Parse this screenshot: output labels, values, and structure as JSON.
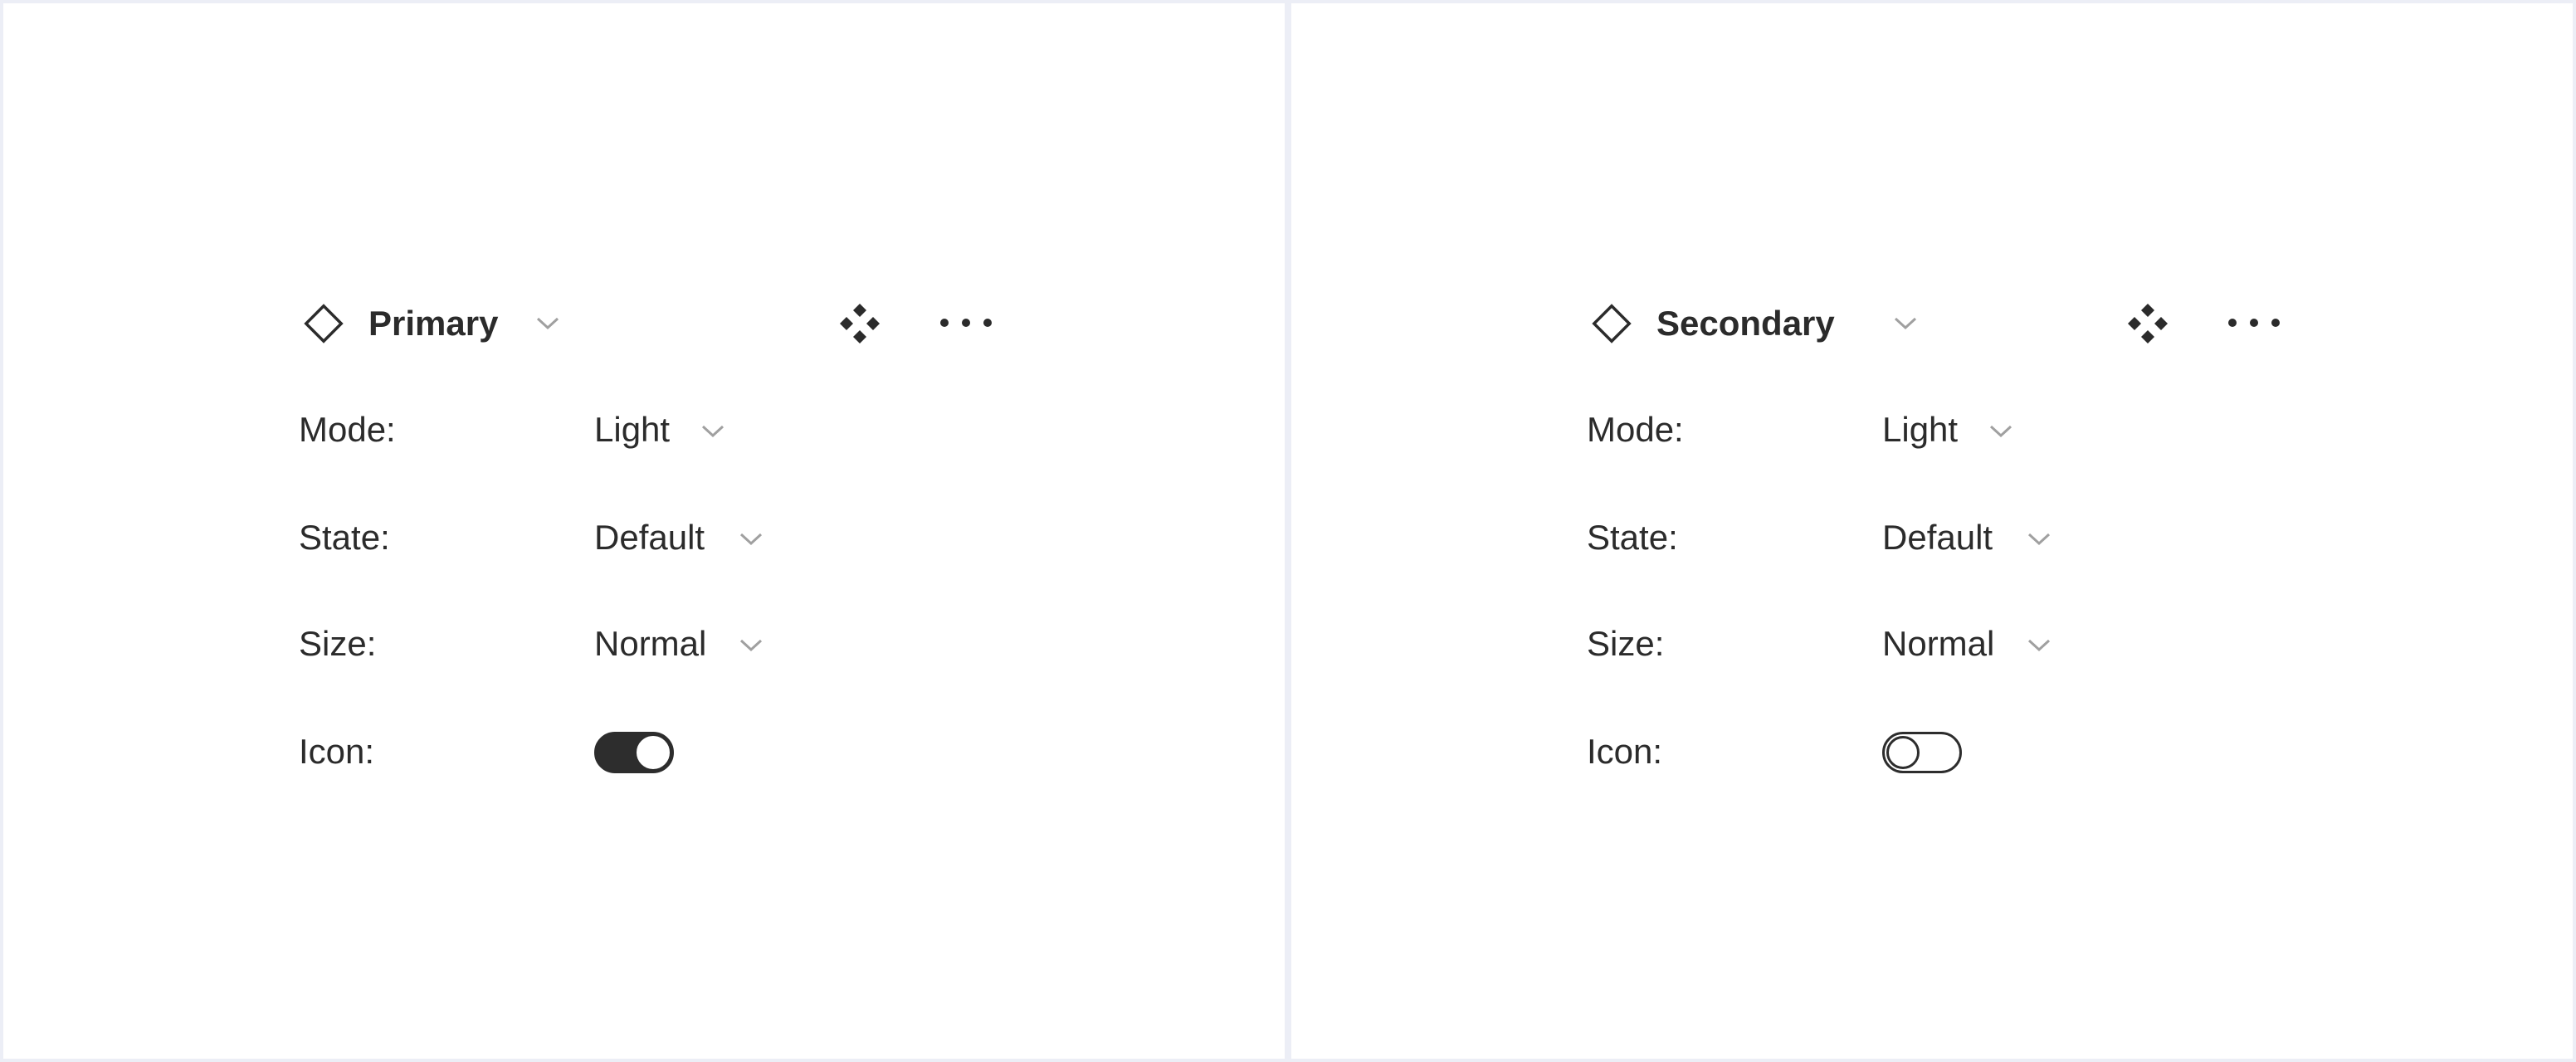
{
  "colors": {
    "background": "#eceef6",
    "panel": "#ffffff",
    "text": "#2b2b2b",
    "toggle_on": "#2d2d2d",
    "chevron": "#a0a0a0"
  },
  "icons": {
    "component": "component-diamond-icon",
    "instance": "four-diamonds-icon",
    "more": "more-horizontal-icon",
    "chevron": "chevron-down-icon"
  },
  "panels": [
    {
      "component_name": "Primary",
      "properties": {
        "mode": {
          "label": "Mode:",
          "value": "Light"
        },
        "state": {
          "label": "State:",
          "value": "Default"
        },
        "size": {
          "label": "Size:",
          "value": "Normal"
        },
        "icon": {
          "label": "Icon:",
          "enabled": true
        }
      }
    },
    {
      "component_name": "Secondary",
      "properties": {
        "mode": {
          "label": "Mode:",
          "value": "Light"
        },
        "state": {
          "label": "State:",
          "value": "Default"
        },
        "size": {
          "label": "Size:",
          "value": "Normal"
        },
        "icon": {
          "label": "Icon:",
          "enabled": false
        }
      }
    }
  ]
}
